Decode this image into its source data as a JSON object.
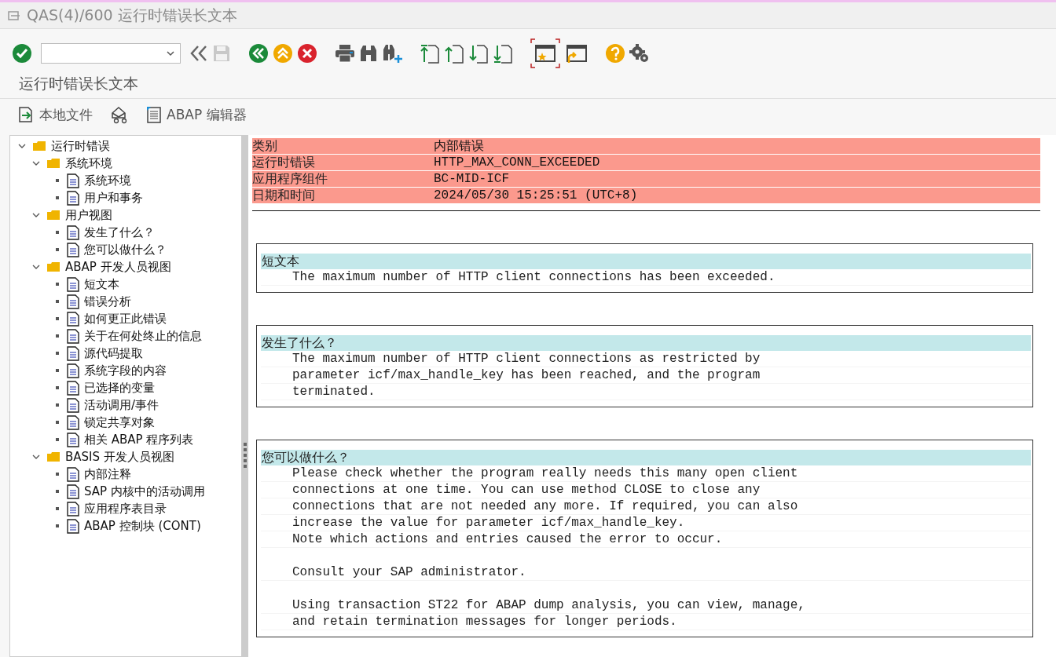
{
  "window": {
    "title": "QAS(4)/600 运行时错误长文本"
  },
  "page_title": "运行时错误长文本",
  "app_toolbar": [
    {
      "kind": "local-file",
      "label": "本地文件"
    },
    {
      "kind": "mail"
    },
    {
      "kind": "editor",
      "label": "ABAP 编辑器"
    }
  ],
  "tree": [
    {
      "label": "运行时错误",
      "kind": "folder",
      "expanded": true,
      "children": [
        {
          "label": "系统环境",
          "kind": "folder",
          "expanded": true,
          "children": [
            {
              "label": "系统环境",
              "kind": "document"
            },
            {
              "label": "用户和事务",
              "kind": "document"
            }
          ]
        },
        {
          "label": "用户视图",
          "kind": "folder",
          "expanded": true,
          "children": [
            {
              "label": "发生了什么？",
              "kind": "document"
            },
            {
              "label": "您可以做什么？",
              "kind": "document"
            }
          ]
        },
        {
          "label": "ABAP 开发人员视图",
          "kind": "folder",
          "expanded": true,
          "children": [
            {
              "label": "短文本",
              "kind": "document"
            },
            {
              "label": "错误分析",
              "kind": "document"
            },
            {
              "label": "如何更正此错误",
              "kind": "document"
            },
            {
              "label": "关于在何处终止的信息",
              "kind": "document"
            },
            {
              "label": "源代码提取",
              "kind": "document"
            },
            {
              "label": "系统字段的内容",
              "kind": "document"
            },
            {
              "label": "已选择的变量",
              "kind": "document"
            },
            {
              "label": "活动调用/事件",
              "kind": "document"
            },
            {
              "label": "锁定共享对象",
              "kind": "document"
            },
            {
              "label": "相关 ABAP 程序列表",
              "kind": "document"
            }
          ]
        },
        {
          "label": "BASIS 开发人员视图",
          "kind": "folder",
          "expanded": true,
          "children": [
            {
              "label": "内部注释",
              "kind": "document"
            },
            {
              "label": "SAP 内核中的活动调用",
              "kind": "document"
            },
            {
              "label": "应用程序表目录",
              "kind": "document"
            },
            {
              "label": "ABAP 控制块 (CONT)",
              "kind": "document"
            }
          ]
        }
      ]
    }
  ],
  "header": [
    {
      "label": "类别",
      "value": "内部错误"
    },
    {
      "label": "运行时错误",
      "value": "HTTP_MAX_CONN_EXCEEDED"
    },
    {
      "label": "应用程序组件",
      "value": "BC-MID-ICF"
    },
    {
      "label": "日期和时间",
      "value": "2024/05/30 15:25:51 (UTC+8)"
    }
  ],
  "sections": [
    {
      "title": "短文本",
      "paragraphs": [
        [
          "The maximum number of HTTP client connections has been exceeded."
        ]
      ]
    },
    {
      "title": "发生了什么？",
      "paragraphs": [
        [
          "The maximum number of HTTP client connections as restricted by",
          "parameter icf/max_handle_key has been reached, and the program",
          "terminated."
        ]
      ]
    },
    {
      "title": "您可以做什么？",
      "paragraphs": [
        [
          "Please check whether the program really needs this many open client",
          "connections at one time. You can use method CLOSE to close any",
          "connections that are not needed any more. If required, you can also",
          "increase the value for parameter icf/max_handle_key.",
          "Note which actions and entries caused the error to occur."
        ],
        [
          "Consult your SAP administrator."
        ],
        [
          "Using transaction ST22 for ABAP dump analysis, you can view, manage,",
          "and retain termination messages for longer periods."
        ]
      ]
    }
  ]
}
